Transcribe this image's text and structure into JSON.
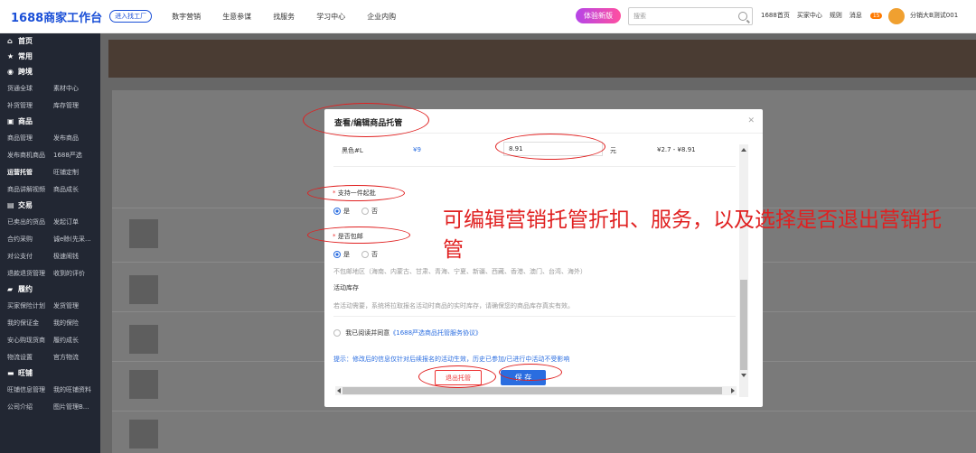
{
  "topbar": {
    "logo": "1688商家工作台",
    "factory_button": "进入找工厂",
    "nav": [
      "数字营销",
      "生意参谋",
      "找服务",
      "学习中心",
      "企业内购"
    ],
    "trial_button": "体验新版",
    "search_placeholder": "搜索",
    "links": [
      "1688首页",
      "买家中心",
      "规则"
    ],
    "messages_label": "消息",
    "messages_count": "15",
    "username": "分销大B测试001"
  },
  "sidebar": {
    "sections": [
      {
        "label": "首页",
        "icon": "home-icon",
        "rows": []
      },
      {
        "label": "常用",
        "icon": "star-icon",
        "rows": []
      },
      {
        "label": "跨境",
        "icon": "globe-icon",
        "rows": [
          [
            "货通全球",
            "素材中心"
          ],
          [
            "补货管理",
            "库存管理"
          ]
        ]
      },
      {
        "label": "商品",
        "icon": "box-icon",
        "rows": [
          [
            "商品管理",
            "发布商品"
          ],
          [
            "发布商机商品",
            "1688严选"
          ],
          [
            "运营托管",
            "旺铺定制"
          ],
          [
            "商品讲解视频",
            "商品成长"
          ]
        ]
      },
      {
        "label": "交易",
        "icon": "cart-icon",
        "rows": [
          [
            "已卖出的货品",
            "发起订单"
          ],
          [
            "合约采购",
            "诚e赊(先采..."
          ],
          [
            "对公支付",
            "极速闹钱"
          ],
          [
            "退款退货管理",
            "收到的评价"
          ]
        ]
      },
      {
        "label": "履约",
        "icon": "truck-icon",
        "rows": [
          [
            "买家保险计划",
            "发货管理"
          ],
          [
            "我的保证金",
            "我的保险"
          ],
          [
            "安心购现货商",
            "履约成长"
          ],
          [
            "物流设置",
            "官方物流"
          ]
        ]
      },
      {
        "label": "旺铺",
        "icon": "shop-icon",
        "rows": [
          [
            "旺铺信息管理",
            "我的旺铺资料"
          ],
          [
            "公司介绍",
            "图片管理B..."
          ]
        ]
      }
    ]
  },
  "modal": {
    "title": "查看/编辑商品托管",
    "sku_name": "黑色#L",
    "sku_price": "¥9",
    "discount_price": "8.91",
    "unit": "元",
    "price_range": "¥2.7 - ¥8.91",
    "wholesale_label": "支持一件起批",
    "wholesale_yes": "是",
    "wholesale_no": "否",
    "shipping_label": "是否包邮",
    "shipping_yes": "是",
    "shipping_no": "否",
    "no_shipping_regions": "不包邮地区（海南、内蒙古、甘肃、青海、宁夏、新疆、西藏、香港、澳门、台湾、海外）",
    "stock_label": "活动库存",
    "stock_note": "若活动需要，系统将拉取报名活动时商品的实时库存，请确保您的商品库存真实有效。",
    "agree_prefix": "我已阅读并同意",
    "agree_link": "《1688严选商品托管服务协议》",
    "hint": "提示：修改后的信息仅针对后续报名的活动生效，历史已参加/已进行中活动不受影响",
    "exit_button": "退出托管",
    "save_button": "保 存"
  },
  "annotation": {
    "text": "可编辑营销托管折扣、服务，以及选择是否退出营销托管",
    "color": "#e02020"
  }
}
